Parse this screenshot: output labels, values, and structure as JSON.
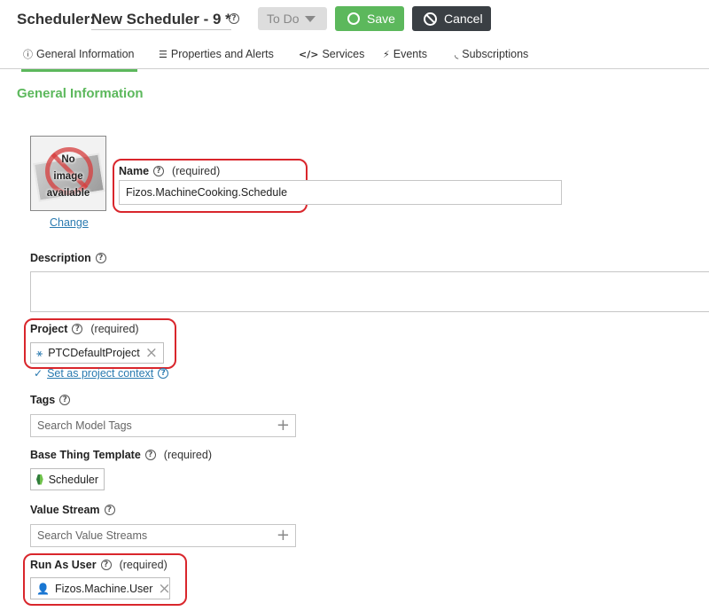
{
  "header": {
    "entity_label": "Scheduler:",
    "entity_name": "New Scheduler - 9 *",
    "status": "To Do",
    "save_label": "Save",
    "cancel_label": "Cancel"
  },
  "tabs": [
    {
      "label": "General Information",
      "icon": "info-icon",
      "active": true
    },
    {
      "label": "Properties and Alerts",
      "icon": "list-icon",
      "active": false
    },
    {
      "label": "Services",
      "icon": "code-icon",
      "active": false
    },
    {
      "label": "Events",
      "icon": "lightning-icon",
      "active": false
    },
    {
      "label": "Subscriptions",
      "icon": "rss-icon",
      "active": false
    }
  ],
  "section_title": "General Information",
  "thumbnail": {
    "placeholder_text": [
      "No",
      "image",
      "available"
    ],
    "change_link": "Change"
  },
  "fields": {
    "name": {
      "label": "Name",
      "required_text": "(required)",
      "value": "Fizos.MachineCooking.Schedule"
    },
    "description": {
      "label": "Description",
      "value": ""
    },
    "project": {
      "label": "Project",
      "required_text": "(required)",
      "value": "PTCDefaultProject",
      "set_context_link": "Set as project context"
    },
    "tags": {
      "label": "Tags",
      "placeholder": "Search Model Tags"
    },
    "base_thing_template": {
      "label": "Base Thing Template",
      "required_text": "(required)",
      "value": "Scheduler"
    },
    "value_stream": {
      "label": "Value Stream",
      "placeholder": "Search Value Streams"
    },
    "run_as_user": {
      "label": "Run As User",
      "required_text": "(required)",
      "value": "Fizos.Machine.User"
    }
  },
  "colors": {
    "accent_green": "#5cb85c",
    "cancel_dark": "#3a3f44",
    "link_blue": "#2a7ab0",
    "highlight_red": "#d9262c"
  }
}
